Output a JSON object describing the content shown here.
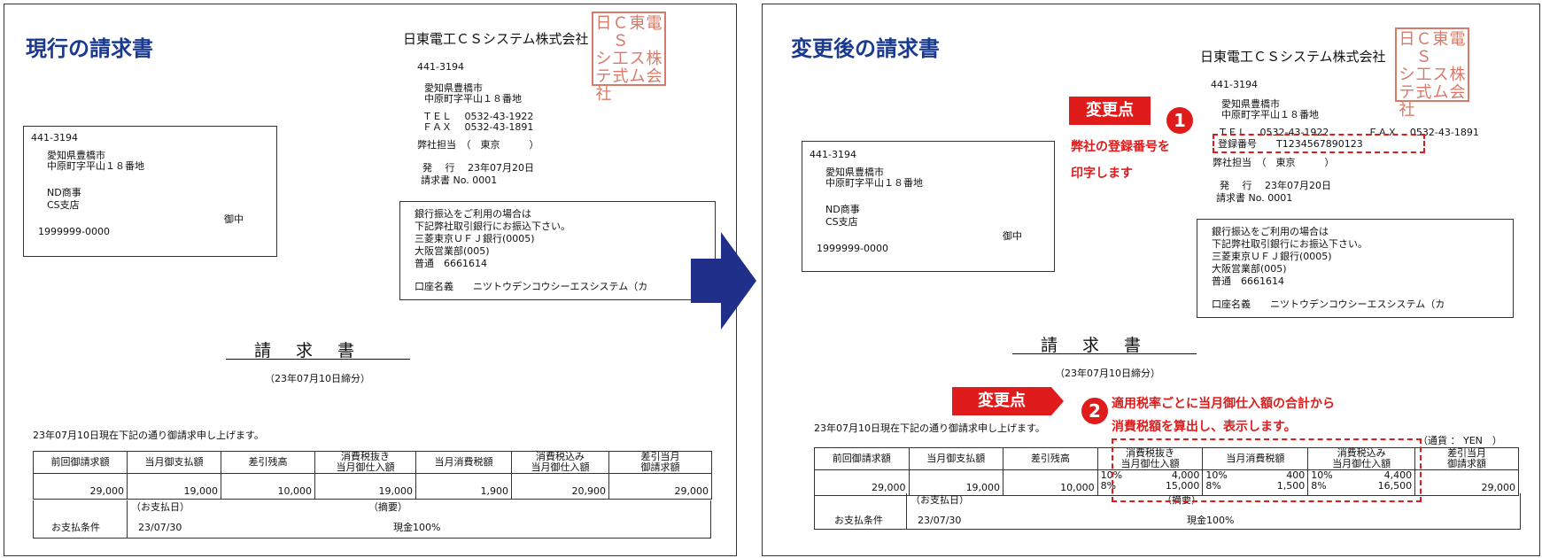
{
  "left": {
    "heading": "現行の請求書",
    "company": "日東電工ＣＳシステム株式会社",
    "seal_chars": [
      "日",
      "ＣＳ",
      "東",
      "電",
      "シ",
      "工",
      "ス",
      "株",
      "テ",
      "式",
      "ム",
      "会",
      "社",
      "",
      "",
      ""
    ],
    "issuer": {
      "zip": "441-3194",
      "addr1": "愛知県豊橋市",
      "addr2": "中原町字平山１８番地",
      "tel": "ＴＥＬ　 0532-43-1922",
      "fax": "ＦＡＸ　 0532-43-1891",
      "person": "弊社担当　（　東京　　　）",
      "issued": "発　 行　 23年07月20日",
      "invoice_no": "請求書 No. 0001"
    },
    "recipient": {
      "zip": "441-3194",
      "addr1": "愛知県豊橋市",
      "addr2": "中原町字平山１８番地",
      "name1": "ND商事",
      "name2": "CS支店",
      "honorific": "御中",
      "code": "1999999-0000"
    },
    "bank": {
      "l1": "銀行振込をご利用の場合は",
      "l2": "下記弊社取引銀行にお振込下さい。",
      "l3": "三菱東京ＵＦＪ銀行(0005)",
      "l4": "大阪営業部(005)",
      "l5": "普通　6661614",
      "l6": "口座名義　　ニツトウデンコウシーエスシステム（カ"
    },
    "title": "請求書",
    "closing": "（23年07月10日締分）",
    "statement": "23年07月10日現在下記の通り御請求申し上げます。",
    "table": {
      "headers": [
        "前回御請求額",
        "当月御支払額",
        "差引残高",
        "消費税抜き\n当月御仕入額",
        "当月消費税額",
        "消費税込み\n当月御仕入額",
        "差引当月\n御請求額"
      ],
      "values": [
        "29,000",
        "19,000",
        "10,000",
        "19,000",
        "1,900",
        "20,900",
        "29,000"
      ],
      "pay_date_label": "（お支払日）",
      "memo_label": "（摘要）",
      "terms_label": "お支払条件",
      "pay_date": "23/07/30",
      "memo": "現金100%"
    }
  },
  "right": {
    "heading": "変更後の請求書",
    "company": "日東電工ＣＳシステム株式会社",
    "issuer": {
      "zip": "441-3194",
      "addr1": "愛知県豊橋市",
      "addr2": "中原町字平山１８番地",
      "telfax": "ＴＥＬ　 0532-43-1922　　　　ＦＡＸ　 0532-43-1891",
      "reg": "登録番号　　T1234567890123",
      "person": "弊社担当　（　東京　　　）",
      "issued": "発　 行　 23年07月20日",
      "invoice_no": "請求書 No. 0001"
    },
    "recipient": {
      "zip": "441-3194",
      "addr1": "愛知県豊橋市",
      "addr2": "中原町字平山１８番地",
      "name1": "ND商事",
      "name2": "CS支店",
      "honorific": "御中",
      "code": "1999999-0000"
    },
    "bank": {
      "l1": "銀行振込をご利用の場合は",
      "l2": "下記弊社取引銀行にお振込下さい。",
      "l3": "三菱東京ＵＦＪ銀行(0005)",
      "l4": "大阪営業部(005)",
      "l5": "普通　6661614",
      "l6": "口座名義　　ニツトウデンコウシーエスシステム（カ"
    },
    "title": "請求書",
    "closing": "（23年07月10日締分）",
    "statement": "23年07月10日現在下記の通り御請求申し上げます。",
    "currency": "（通貨 ： YEN　）",
    "table": {
      "headers": [
        "前回御請求額",
        "当月御支払額",
        "差引残高",
        "消費税抜き\n当月御仕入額",
        "当月消費税額",
        "消費税込み\n当月御仕入額",
        "差引当月\n御請求額"
      ],
      "prev": "29,000",
      "paid": "19,000",
      "balance": "10,000",
      "excl": [
        {
          "rate": "10%",
          "amount": "4,000"
        },
        {
          "rate": "8%",
          "amount": "15,000"
        }
      ],
      "tax": [
        {
          "rate": "10%",
          "amount": "400"
        },
        {
          "rate": "8%",
          "amount": "1,500"
        }
      ],
      "incl": [
        {
          "rate": "10%",
          "amount": "4,400"
        },
        {
          "rate": "8%",
          "amount": "16,500"
        }
      ],
      "billing": "29,000",
      "pay_date_label": "（お支払日）",
      "memo_label": "（摘要）",
      "terms_label": "お支払条件",
      "pay_date": "23/07/30",
      "memo": "現金100%"
    },
    "callout1": {
      "badge": "変更点",
      "number": "1",
      "line1": "弊社の登録番号を",
      "line2": "印字します"
    },
    "callout2": {
      "badge": "変更点",
      "number": "2",
      "line1": "適用税率ごとに当月御仕入額の合計から",
      "line2": "消費税額を算出し、表示します。"
    }
  },
  "colors": {
    "heading": "#1a3a8f",
    "arrow": "#1f2f8a",
    "accent": "#e01b1b",
    "seal": "#d77a6a"
  }
}
